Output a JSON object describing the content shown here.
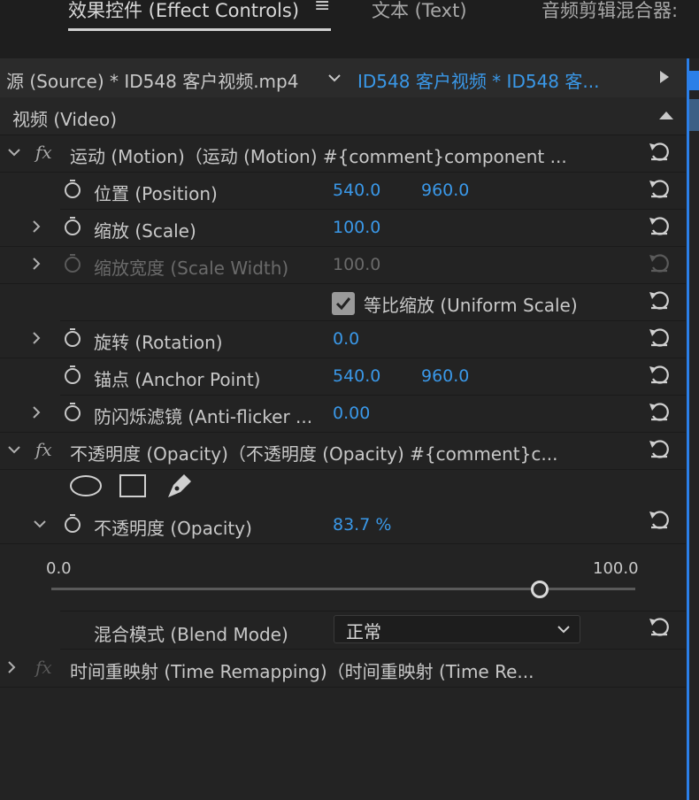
{
  "tabs": [
    {
      "label": "效果控件 (Effect Controls)",
      "active": true
    },
    {
      "label": "文本 (Text)",
      "active": false
    },
    {
      "label": "音频剪辑混合器:",
      "active": false
    }
  ],
  "tab_menu_icon": "hamburger-menu-icon",
  "source_bar": {
    "source_label": "源 (Source) * ID548 客户视频.mp4",
    "sequence_label": "ID548 客户视频 * ID548 客...",
    "dropdown_icon": "chevron-down-icon",
    "play_icon": "play-triangle-icon"
  },
  "section": {
    "title": "视频 (Video)",
    "collapse_icon": "triangle-up-icon"
  },
  "motion": {
    "header": "运动 (Motion)（运动 (Motion)  #{comment}component ...",
    "position": {
      "label": "位置 (Position)",
      "x": "540.0",
      "y": "960.0"
    },
    "scale": {
      "label": "缩放 (Scale)",
      "value": "100.0"
    },
    "scale_width": {
      "label": "缩放宽度 (Scale Width)",
      "value": "100.0"
    },
    "uniform_scale": {
      "label": "等比缩放 (Uniform Scale)",
      "checked": true
    },
    "rotation": {
      "label": "旋转 (Rotation)",
      "value": "0.0"
    },
    "anchor": {
      "label": "锚点 (Anchor Point)",
      "x": "540.0",
      "y": "960.0"
    },
    "antiflicker": {
      "label": "防闪烁滤镜 (Anti-flicker ...",
      "value": "0.00"
    }
  },
  "opacity": {
    "header": "不透明度 (Opacity)（不透明度 (Opacity)  #{comment}c...",
    "mask_tools": [
      "ellipse-mask-icon",
      "rectangle-mask-icon",
      "pen-mask-icon"
    ],
    "opacity_label": "不透明度 (Opacity)",
    "opacity_value": "83.7 %",
    "slider_min": "0.0",
    "slider_max": "100.0",
    "slider_fraction": 0.837,
    "blend_label": "混合模式 (Blend Mode)",
    "blend_value": "正常"
  },
  "time_remap": {
    "header": "时间重映射 (Time Remapping)（时间重映射 (Time Re..."
  },
  "icons": {
    "reset": "reset-icon",
    "stopwatch": "stopwatch-icon",
    "fx": "fx-icon"
  },
  "colors": {
    "accent_blue": "#3a98e8",
    "background": "#232323",
    "playhead": "#2b7fe8"
  }
}
